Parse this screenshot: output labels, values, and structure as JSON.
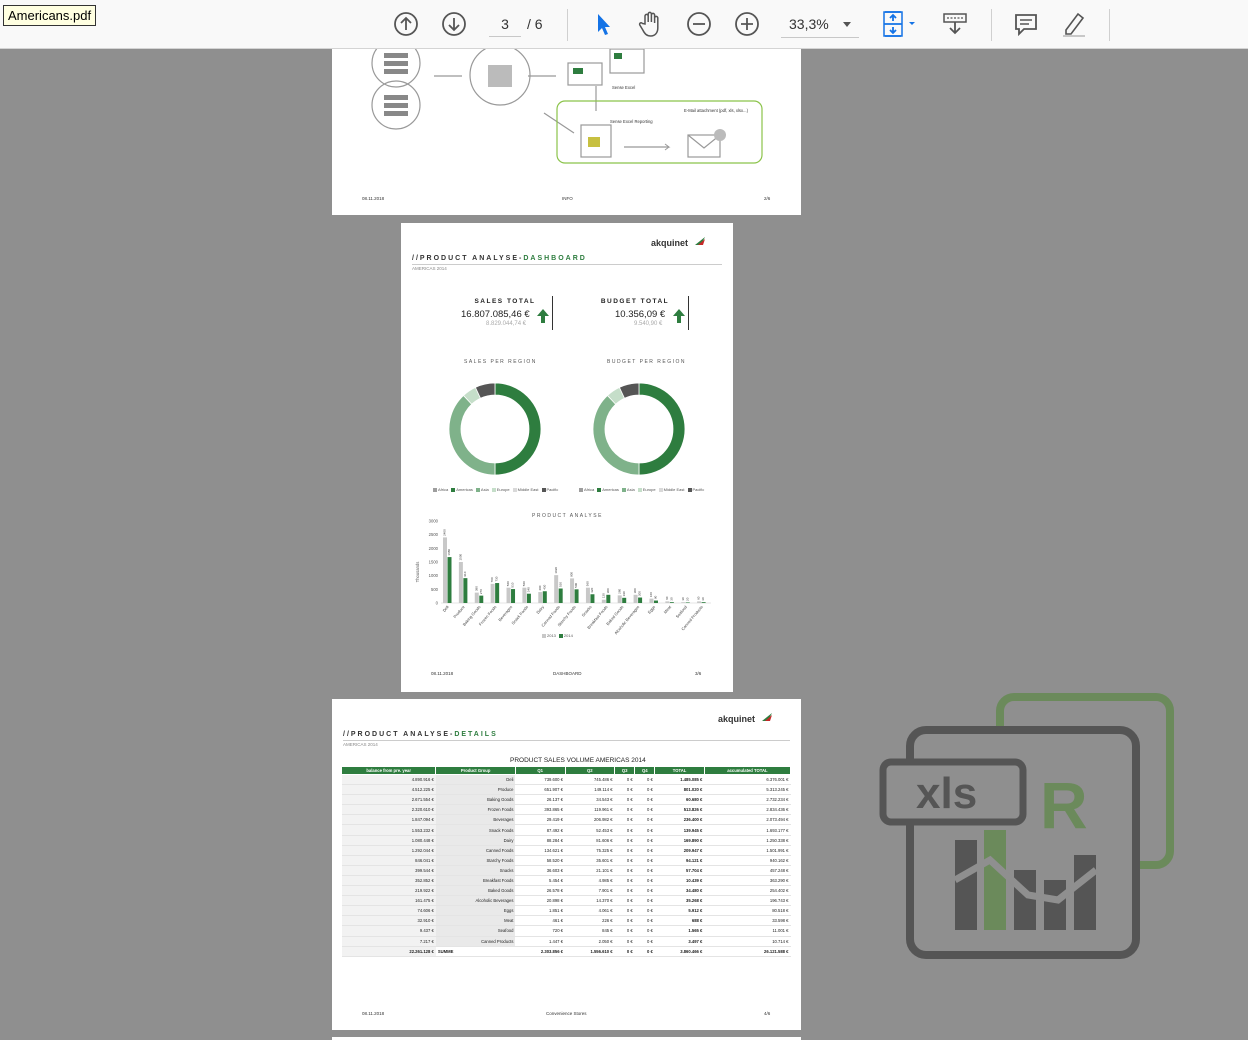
{
  "document": {
    "filename": "Americans.pdf"
  },
  "toolbar": {
    "current_page": "3",
    "total_pages": "/ 6",
    "zoom": "33,3%",
    "icons": [
      "arrow-up-circle-icon",
      "arrow-down-circle-icon",
      "pointer-arrow-icon",
      "hand-icon",
      "zoom-out-icon",
      "zoom-in-icon",
      "fit-page-icon",
      "scroll-mode-icon",
      "comment-icon",
      "highlight-pen-icon"
    ]
  },
  "colors": {
    "accent_green": "#2e7d3f",
    "toolbar_blue": "#1473e6",
    "viewer_bg": "#8f8f8f"
  },
  "page_info": {
    "footer_date": "08.11.2018",
    "footer_center": "INFO",
    "footer_page": "2/6",
    "labels": {
      "sense_excel": "Sense Excel",
      "sense_excel_reporting": "Sense Excel Reporting",
      "email": "E-Mail attachment (pdf, xls, xlsx...)"
    }
  },
  "page_dashboard": {
    "logo": "akquinet",
    "title_prefix": "//PRODUCT ANALYSE-",
    "title_accent": "DASHBOARD",
    "subtitle": "AMERICAS 2014",
    "sales_total_label": "SALES TOTAL",
    "sales_total_value": "16.807.085,46 €",
    "sales_total_prev": "8.829.044,74 €",
    "budget_total_label": "BUDGET TOTAL",
    "budget_total_value": "10.356,09 €",
    "budget_total_prev": "9.540,90 €",
    "sales_region_title": "SALES PER REGION",
    "budget_region_title": "BUDGET PER REGION",
    "product_analyse_title": "PRODUCT ANALYSE",
    "legend_regions": [
      "Africa",
      "Americas",
      "Asia",
      "Europe",
      "Middle East",
      "Pacific"
    ],
    "legend_years": [
      "2013",
      "2014"
    ],
    "y_axis_label": "Thousands",
    "footer_date": "08.11.2018",
    "footer_center": "DASHBOARD",
    "footer_page": "3/6"
  },
  "chart_data": [
    {
      "type": "pie",
      "title": "SALES PER REGION",
      "categories": [
        "Africa",
        "Americas",
        "Asia",
        "Europe",
        "Middle East",
        "Pacific"
      ],
      "values": [
        0,
        50,
        38,
        5,
        0,
        7
      ]
    },
    {
      "type": "pie",
      "title": "BUDGET PER REGION",
      "categories": [
        "Africa",
        "Americas",
        "Asia",
        "Europe",
        "Middle East",
        "Pacific"
      ],
      "values": [
        0,
        50,
        38,
        5,
        0,
        7
      ]
    },
    {
      "type": "bar",
      "title": "PRODUCT ANALYSE",
      "ylabel": "Thousands",
      "ylim": [
        0,
        3000
      ],
      "yticks": [
        "3000",
        "2500",
        "2000",
        "1500",
        "1000",
        "500",
        "0"
      ],
      "categories": [
        "Deli",
        "Produce",
        "Baking Goods",
        "Frozen Foods",
        "Beverages",
        "Snack Foods",
        "Dairy",
        "Canned Foods",
        "Starchy Foods",
        "Snacks",
        "Breakfast Foods",
        "Baked Goods",
        "Alcoholic Beverages",
        "Eggs",
        "Meat",
        "Seafood",
        "Canned Products"
      ],
      "series": [
        {
          "name": "2013",
          "values": [
            2400,
            1500,
            380,
            700,
            560,
            560,
            400,
            1020,
            900,
            560,
            120,
            280,
            300,
            160,
            60,
            30,
            60
          ]
        },
        {
          "name": "2014",
          "values": [
            1680,
            910,
            270,
            730,
            510,
            340,
            430,
            530,
            500,
            320,
            300,
            190,
            200,
            90,
            30,
            20,
            30
          ]
        }
      ]
    }
  ],
  "page_details": {
    "logo": "akquinet",
    "title_prefix": "//PRODUCT ANALYSE-",
    "title_accent": "DETAILS",
    "subtitle": "AMERICAS 2014",
    "table_title": "PRODUCT SALES VOLUME AMERICAS 2014",
    "columns": [
      "balance from pre. year",
      "Product Group",
      "Q1",
      "Q2",
      "Q3",
      "Q4",
      "TOTAL",
      "accumulated TOTAL"
    ],
    "rows": [
      [
        "4.890.916 €",
        "Deli",
        "739.600 €",
        "745.486 €",
        "0 €",
        "0 €",
        "1.485.085 €",
        "6.376.001 €"
      ],
      [
        "4.512.225 €",
        "Produce",
        "651.907 €",
        "149.114 €",
        "0 €",
        "0 €",
        "801.020 €",
        "5.313.245 €"
      ],
      [
        "2.671.554 €",
        "Baking Goods",
        "26.137 €",
        "34.543 €",
        "0 €",
        "0 €",
        "60.680 €",
        "2.732.234 €"
      ],
      [
        "2.320.610 €",
        "Frozen Foods",
        "393.865 €",
        "119.961 €",
        "0 €",
        "0 €",
        "513.826 €",
        "2.834.436 €"
      ],
      [
        "1.847.094 €",
        "Beverages",
        "29.419 €",
        "206.982 €",
        "0 €",
        "0 €",
        "236.400 €",
        "2.073.494 €"
      ],
      [
        "1.553.232 €",
        "Snack Foods",
        "87.492 €",
        "52.453 €",
        "0 €",
        "0 €",
        "139.945 €",
        "1.693.177 €"
      ],
      [
        "1.080.448 €",
        "Dairy",
        "88.284 €",
        "81.606 €",
        "0 €",
        "0 €",
        "169.890 €",
        "1.250.338 €"
      ],
      [
        "1.292.044 €",
        "Canned Foods",
        "134.621 €",
        "75.325 €",
        "0 €",
        "0 €",
        "209.947 €",
        "1.501.991 €"
      ],
      [
        "846.041 €",
        "Starchy Foods",
        "58.520 €",
        "35.601 €",
        "0 €",
        "0 €",
        "94.121 €",
        "940.162 €"
      ],
      [
        "399.544 €",
        "Snacks",
        "36.603 €",
        "21.101 €",
        "0 €",
        "0 €",
        "57.704 €",
        "457.248 €"
      ],
      [
        "352.852 €",
        "Breakfast Foods",
        "5.454 €",
        "4.985 €",
        "0 €",
        "0 €",
        "10.439 €",
        "363.290 €"
      ],
      [
        "219.922 €",
        "Baked Goods",
        "26.578 €",
        "7.901 €",
        "0 €",
        "0 €",
        "34.480 €",
        "254.402 €"
      ],
      [
        "161.475 €",
        "Alcoholic Beverages",
        "20.898 €",
        "14.370 €",
        "0 €",
        "0 €",
        "35.268 €",
        "196.743 €"
      ],
      [
        "74.606 €",
        "Eggs",
        "1.851 €",
        "4.061 €",
        "0 €",
        "0 €",
        "5.912 €",
        "80.518 €"
      ],
      [
        "32.910 €",
        "Meat",
        "461 €",
        "226 €",
        "0 €",
        "0 €",
        "688 €",
        "33.598 €"
      ],
      [
        "9.437 €",
        "Seafood",
        "720 €",
        "845 €",
        "0 €",
        "0 €",
        "1.565 €",
        "11.001 €"
      ],
      [
        "7.217 €",
        "Canned Products",
        "1.447 €",
        "2.050 €",
        "0 €",
        "0 €",
        "3.497 €",
        "10.714 €"
      ]
    ],
    "sum_row": [
      "22.261.128 €",
      "SUMME",
      "2.303.856 €",
      "1.556.610 €",
      "0 €",
      "0 €",
      "3.860.466 €",
      "26.121.588 €"
    ],
    "footer_date": "08.11.2018",
    "footer_center": "Convenience Stores",
    "footer_page": "4/6"
  },
  "watermark": {
    "badge_left": "xls",
    "badge_right": "R"
  }
}
